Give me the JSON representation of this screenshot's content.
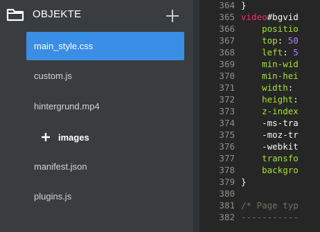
{
  "sidebar": {
    "title": "OBJEKTE",
    "header_icon": "folder-icon",
    "add_icon": "plus-icon",
    "files": [
      {
        "label": "main_style.css",
        "active": true
      },
      {
        "label": "custom.js",
        "active": false
      },
      {
        "label": "hintergrund.mp4",
        "active": false
      },
      {
        "label": "manifest.json",
        "active": false
      },
      {
        "label": "plugins.js",
        "active": false
      }
    ],
    "folder": {
      "label": "images",
      "icon": "plus-icon"
    }
  },
  "editor": {
    "lines": [
      {
        "no": "364",
        "tokens": [
          {
            "t": "}",
            "c": "plain"
          }
        ]
      },
      {
        "no": "365",
        "tokens": [
          {
            "t": "video",
            "c": "tag"
          },
          {
            "t": "#bgvid",
            "c": "plain"
          }
        ]
      },
      {
        "no": "366",
        "tokens": [
          {
            "t": "    positio",
            "c": "prop"
          }
        ]
      },
      {
        "no": "367",
        "tokens": [
          {
            "t": "    top",
            "c": "prop"
          },
          {
            "t": ": ",
            "c": "plain"
          },
          {
            "t": "50",
            "c": "num"
          }
        ]
      },
      {
        "no": "368",
        "tokens": [
          {
            "t": "    left",
            "c": "prop"
          },
          {
            "t": ": ",
            "c": "plain"
          },
          {
            "t": "5",
            "c": "num"
          }
        ]
      },
      {
        "no": "369",
        "tokens": [
          {
            "t": "    min-wid",
            "c": "prop"
          }
        ]
      },
      {
        "no": "370",
        "tokens": [
          {
            "t": "    min-hei",
            "c": "prop"
          }
        ]
      },
      {
        "no": "371",
        "tokens": [
          {
            "t": "    width",
            "c": "prop"
          },
          {
            "t": ":",
            "c": "plain"
          }
        ]
      },
      {
        "no": "372",
        "tokens": [
          {
            "t": "    height",
            "c": "prop"
          },
          {
            "t": ":",
            "c": "plain"
          }
        ]
      },
      {
        "no": "373",
        "tokens": [
          {
            "t": "    z-index",
            "c": "prop"
          }
        ]
      },
      {
        "no": "374",
        "tokens": [
          {
            "t": "    -ms-tra",
            "c": "plain"
          }
        ]
      },
      {
        "no": "375",
        "tokens": [
          {
            "t": "    -moz-tr",
            "c": "plain"
          }
        ]
      },
      {
        "no": "376",
        "tokens": [
          {
            "t": "    -webkit",
            "c": "plain"
          }
        ]
      },
      {
        "no": "377",
        "tokens": [
          {
            "t": "    transfo",
            "c": "prop"
          }
        ]
      },
      {
        "no": "378",
        "tokens": [
          {
            "t": "    backgro",
            "c": "prop"
          }
        ]
      },
      {
        "no": "379",
        "tokens": [
          {
            "t": "}",
            "c": "plain"
          }
        ]
      },
      {
        "no": "380",
        "tokens": []
      },
      {
        "no": "381",
        "tokens": [
          {
            "t": "/* Page typ",
            "c": "comment"
          }
        ]
      },
      {
        "no": "382",
        "tokens": [
          {
            "t": "-----------",
            "c": "comment"
          }
        ]
      }
    ]
  },
  "colors": {
    "sidebar_bg": "#393d40",
    "active_item": "#3a8ee6",
    "editor_bg": "#262626",
    "tag": "#f92672",
    "property": "#a6e22e",
    "number": "#ae81ff",
    "comment": "#75715e"
  }
}
